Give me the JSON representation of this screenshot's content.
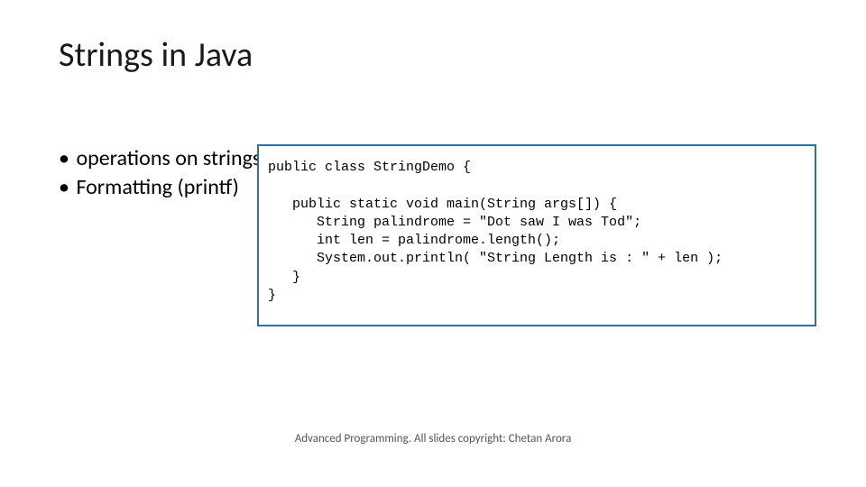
{
  "title": "Strings in Java",
  "bullets": [
    "operations on strings",
    "Formatting (printf)"
  ],
  "code": {
    "l1": "public class StringDemo {",
    "l2": "",
    "l3": "   public static void main(String args[]) {",
    "l4": "      String palindrome = \"Dot saw I was Tod\";",
    "l5": "      int len = palindrome.length();",
    "l6": "      System.out.println( \"String Length is : \" + len );",
    "l7": "   }",
    "l8": "}"
  },
  "footer": "Advanced Programming. All slides copyright: Chetan Arora"
}
